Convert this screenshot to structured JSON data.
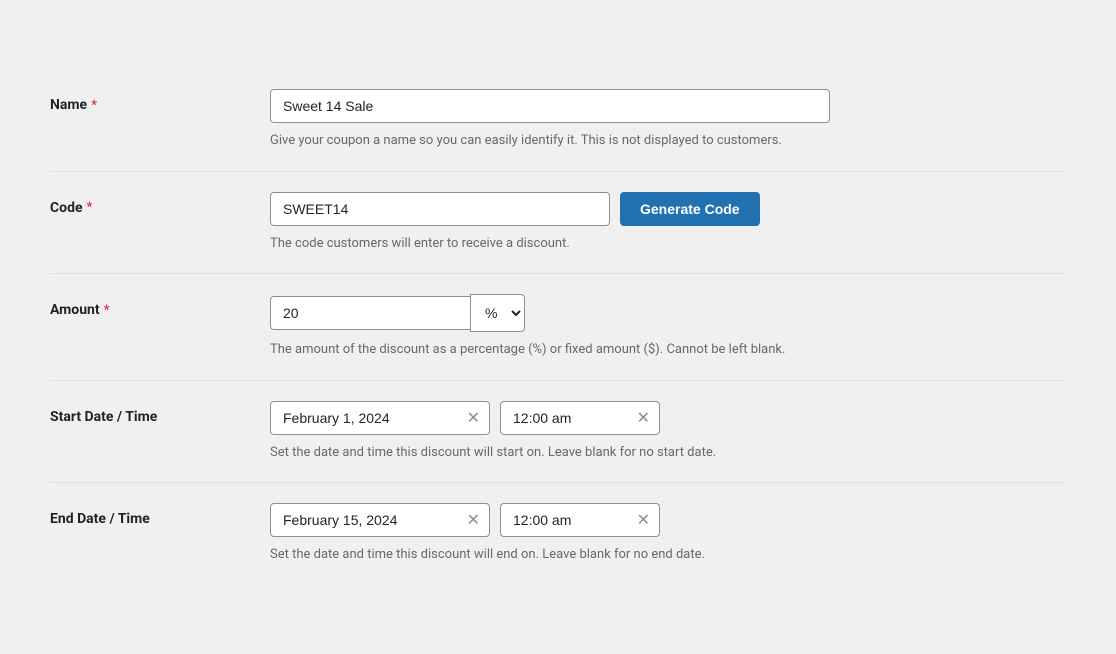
{
  "form": {
    "name": {
      "label": "Name",
      "required": true,
      "value": "Sweet 14 Sale",
      "help_text": "Give your coupon a name so you can easily identify it. This is not displayed to customers."
    },
    "code": {
      "label": "Code",
      "required": true,
      "value": "SWEET14",
      "help_text": "The code customers will enter to receive a discount.",
      "generate_button_label": "Generate Code"
    },
    "amount": {
      "label": "Amount",
      "required": true,
      "value": "20",
      "unit": "%",
      "help_text": "The amount of the discount as a percentage (%) or fixed amount ($). Cannot be left blank.",
      "options": [
        "%",
        "$"
      ]
    },
    "start_date": {
      "label": "Start Date / Time",
      "date_value": "February 1, 2024",
      "time_value": "12:00 am",
      "help_text": "Set the date and time this discount will start on. Leave blank for no start date."
    },
    "end_date": {
      "label": "End Date / Time",
      "date_value": "February 15, 2024",
      "time_value": "12:00 am",
      "help_text": "Set the date and time this discount will end on. Leave blank for no end date."
    }
  },
  "icons": {
    "clear": "✕",
    "chevron_down": "▾"
  }
}
